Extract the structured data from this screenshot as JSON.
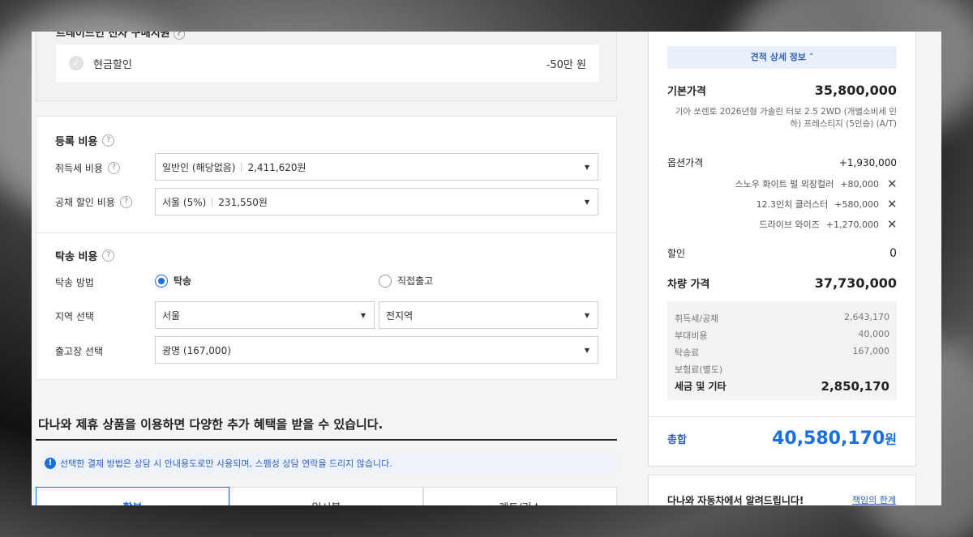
{
  "left": {
    "top_card": {
      "heading": "트레이드인 전자 구매지원",
      "cash_label": "현금할인",
      "cash_value": "-50만 원"
    },
    "registration": {
      "title": "등록 비용",
      "acq_tax_label": "취득세 비용",
      "acq_tax_type": "일반인 (해당없음)",
      "acq_tax_amount": "2,411,620원",
      "bond_label": "공채 할인 비용",
      "bond_region": "서울 (5%)",
      "bond_amount": "231,550원"
    },
    "delivery": {
      "title": "탁송 비용",
      "method_label": "탁송 방법",
      "option_delivery": "탁송",
      "option_pickup": "직접출고",
      "region_label": "지역 선택",
      "region_value": "서울",
      "district_value": "전지역",
      "depot_label": "출고장 선택",
      "depot_value": "광명 (167,000)"
    },
    "promo_title": "다나와 제휴 상품을 이용하면 다양한 추가 혜택을 받을 수 있습니다.",
    "notice": "선택한 결제 방법은 상담 시 안내용도로만 사용되며, 스팸성 상담 연락을 드리지 않습니다.",
    "tabs": [
      "할부",
      "일시불",
      "렌트/리스"
    ]
  },
  "right": {
    "estimate_button": "견적 상세 정보",
    "base_price_label": "기본가격",
    "base_price": "35,800,000",
    "model_desc": "기아 쏘렌토 2026년형 가솔린 터보 2.5 2WD (개별소비세 인하) 프레스티지 (5인승) (A/T)",
    "option_price_label": "옵션가격",
    "option_price": "+1,930,000",
    "options": [
      {
        "name": "스노우 화이트 펄 외장컬러",
        "price": "+80,000"
      },
      {
        "name": "12.3인치 클러스터",
        "price": "+580,000"
      },
      {
        "name": "드라이브 와이즈",
        "price": "+1,270,000"
      }
    ],
    "discount_label": "할인",
    "discount": "0",
    "car_price_label": "차량 가격",
    "car_price": "37,730,000",
    "tax": {
      "acq_label": "취득세/공채",
      "acq": "2,643,170",
      "extra_label": "부대비용",
      "extra": "40,000",
      "delivery_label": "탁송료",
      "delivery": "167,000",
      "insurance_label": "보험료(별도)",
      "sum_label": "세금 및 기타",
      "sum": "2,850,170"
    },
    "total_label": "총합",
    "total": "40,580,170",
    "total_unit": "원",
    "notice_title": "다나와 자동차에서 알려드립니다!",
    "notice_link": "책임의 한계"
  },
  "colors": {
    "accent": "#1a6fe0",
    "accent_text": "#2f62c0",
    "accent_bg": "#e9f0fb"
  }
}
